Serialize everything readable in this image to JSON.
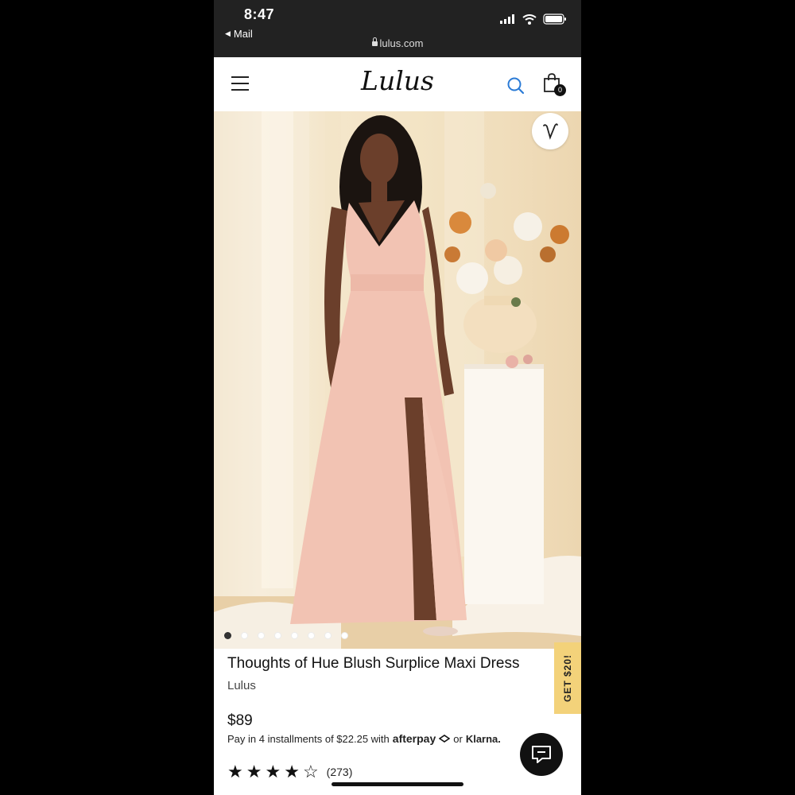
{
  "status_bar": {
    "time": "8:47",
    "back_app": "Mail",
    "url": "lulus.com",
    "icons": [
      "signal-icon",
      "wifi-icon",
      "battery-icon"
    ]
  },
  "header": {
    "logo": "Lulus",
    "menu_icon": "hamburger-menu-icon",
    "search_icon": "search-icon",
    "bag_icon": "shopping-bag-icon",
    "bag_count": "0"
  },
  "gallery": {
    "image_count": 8,
    "active_index": 0,
    "wishlist_icon": "heart-icon"
  },
  "product": {
    "title": "Thoughts of Hue Blush Surplice Maxi Dress",
    "brand": "Lulus",
    "price": "$89",
    "installments_text": "Pay in 4 installments of $22.25 with",
    "afterpay": "afterpay",
    "or": "or",
    "klarna": "Klarna.",
    "rating": 4.5,
    "review_count": "(273)"
  },
  "promo": {
    "label": "GET $20!"
  },
  "chat": {
    "icon": "chat-icon"
  },
  "colors": {
    "status_bar_bg": "#222222",
    "search_icon": "#2b7bd6",
    "promo_bg": "#f3d27a",
    "dress": "#f2c3b3"
  }
}
